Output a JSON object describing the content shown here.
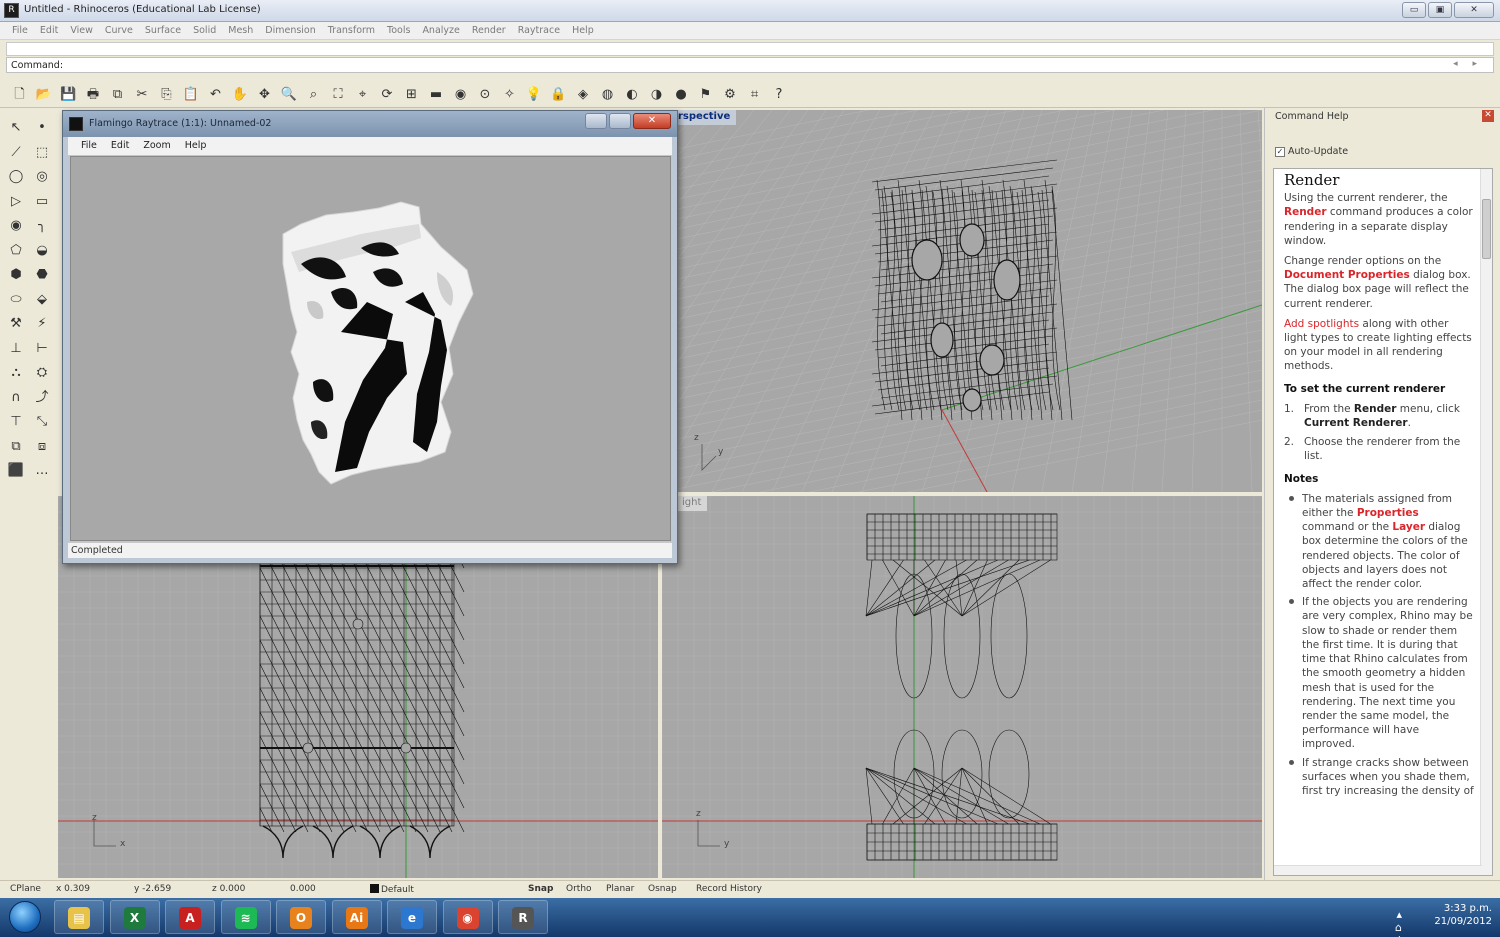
{
  "window": {
    "title": "Untitled - Rhinoceros (Educational Lab License)",
    "minimize": "▭",
    "maximize": "▣",
    "close": "✕"
  },
  "menu": [
    "File",
    "Edit",
    "View",
    "Curve",
    "Surface",
    "Solid",
    "Mesh",
    "Dimension",
    "Transform",
    "Tools",
    "Analyze",
    "Render",
    "Raytrace",
    "Help"
  ],
  "command": {
    "label": "Command:",
    "arrows": "◂ ▸"
  },
  "toolbar_icons": [
    {
      "name": "new-file-icon",
      "glyph": "🗋"
    },
    {
      "name": "open-file-icon",
      "glyph": "📂"
    },
    {
      "name": "save-icon",
      "glyph": "💾"
    },
    {
      "name": "print-icon",
      "glyph": "🖶"
    },
    {
      "name": "import-icon",
      "glyph": "⧉"
    },
    {
      "name": "cut-icon",
      "glyph": "✂"
    },
    {
      "name": "copy-icon",
      "glyph": "⎘"
    },
    {
      "name": "paste-icon",
      "glyph": "📋"
    },
    {
      "name": "undo-icon",
      "glyph": "↶"
    },
    {
      "name": "pan-icon",
      "glyph": "✋"
    },
    {
      "name": "move-view-icon",
      "glyph": "✥"
    },
    {
      "name": "zoom-icon",
      "glyph": "🔍"
    },
    {
      "name": "zoom-window-icon",
      "glyph": "⌕"
    },
    {
      "name": "zoom-extents-icon",
      "glyph": "⛶"
    },
    {
      "name": "zoom-selected-icon",
      "glyph": "⌖"
    },
    {
      "name": "rotate-view-icon",
      "glyph": "⟳"
    },
    {
      "name": "four-viewports-icon",
      "glyph": "⊞"
    },
    {
      "name": "construction-plane-icon",
      "glyph": "▬"
    },
    {
      "name": "hide-icon",
      "glyph": "◉"
    },
    {
      "name": "snap-icon",
      "glyph": "⊙"
    },
    {
      "name": "select-icon",
      "glyph": "✧"
    },
    {
      "name": "light-icon",
      "glyph": "💡"
    },
    {
      "name": "lock-icon",
      "glyph": "🔒"
    },
    {
      "name": "layer-icon",
      "glyph": "◈"
    },
    {
      "name": "color-wheel-icon",
      "glyph": "◍"
    },
    {
      "name": "shaded-sphere-icon",
      "glyph": "◐"
    },
    {
      "name": "ghosted-sphere-icon",
      "glyph": "◑"
    },
    {
      "name": "render-sphere-icon",
      "glyph": "●"
    },
    {
      "name": "flag-icon",
      "glyph": "⚑"
    },
    {
      "name": "settings-gear-icon",
      "glyph": "⚙"
    },
    {
      "name": "grid-snap-icon",
      "glyph": "⌗"
    },
    {
      "name": "help-icon",
      "glyph": "?"
    }
  ],
  "left_tools": [
    "↖",
    "•",
    "⟋",
    "⬚",
    "◯",
    "◎",
    "▷",
    "▭",
    "◉",
    "╮",
    "⬠",
    "◒",
    "⬢",
    "⬣",
    "⬭",
    "⬙",
    "⚒",
    "⚡",
    "⊥",
    "⊢",
    "⛬",
    "⛭",
    "∩",
    "⤴",
    "⊤",
    "⤡",
    "⧉",
    "⧈",
    "⬛",
    "…"
  ],
  "viewports": {
    "perspective_label": "rspective",
    "right_label": "ight"
  },
  "flamingo": {
    "title": "Flamingo Raytrace (1:1): Unnamed-02",
    "menu": [
      "File",
      "Edit",
      "Zoom",
      "Help"
    ],
    "status": "Completed"
  },
  "help_panel": {
    "header": "Command Help",
    "auto_update": "Auto-Update",
    "title": "Render",
    "p1_a": "Using the current renderer, the ",
    "p1_link": "Render",
    "p1_b": " command produces a color rendering in a separate display window.",
    "p2_a": "Change render options on the ",
    "p2_link": "Document Properties",
    "p2_b": " dialog box. The dialog box page will reflect the current renderer.",
    "p3_link": "Add spotlights",
    "p3_b": " along with other light types to create lighting effects on your model in all rendering methods.",
    "section1": "To set the current renderer",
    "step1_a": "From the ",
    "step1_b": "Render",
    "step1_c": " menu, click ",
    "step1_d": "Current Renderer",
    "step1_e": ".",
    "step2": "Choose the renderer from the list.",
    "notes": "Notes",
    "note1_a": "The materials assigned from either the ",
    "note1_b": "Properties",
    "note1_c": " command or the ",
    "note1_d": "Layer",
    "note1_e": " dialog box determine the colors of the rendered objects. The color of objects and layers does not affect the render color.",
    "note2": "If the objects you are rendering are very complex, Rhino may be slow to shade or render them the first time. It is during that time that Rhino calculates from the smooth geometry a hidden mesh that is used for the rendering. The next time you render the same model, the performance will have improved.",
    "note3": "If strange cracks show between surfaces when you shade them, first try increasing the density of"
  },
  "statusbar": {
    "cplane": "CPlane",
    "x": "x 0.309",
    "y": "y -2.659",
    "z": "z 0.000",
    "extra": "0.000",
    "layer": "Default",
    "snap": "Snap",
    "ortho": "Ortho",
    "planar": "Planar",
    "osnap": "Osnap",
    "record": "Record History"
  },
  "taskbar": {
    "apps": [
      {
        "name": "explorer-icon",
        "glyph": "▤",
        "color": "#e8c34a"
      },
      {
        "name": "excel-icon",
        "glyph": "X",
        "color": "#1f7a3d"
      },
      {
        "name": "acrobat-icon",
        "glyph": "A",
        "color": "#c8201f"
      },
      {
        "name": "spotify-icon",
        "glyph": "≋",
        "color": "#1db954"
      },
      {
        "name": "outlook-icon",
        "glyph": "O",
        "color": "#e8821c"
      },
      {
        "name": "illustrator-icon",
        "glyph": "Ai",
        "color": "#e87716"
      },
      {
        "name": "internet-explorer-icon",
        "glyph": "e",
        "color": "#2c78d0"
      },
      {
        "name": "chrome-icon",
        "glyph": "◉",
        "color": "#d9432f"
      },
      {
        "name": "rhino-icon",
        "glyph": "R",
        "color": "#555555"
      }
    ],
    "time": "3:33 p.m.",
    "date": "21/09/2012",
    "tray": "▴ ⌂ ◂)"
  }
}
